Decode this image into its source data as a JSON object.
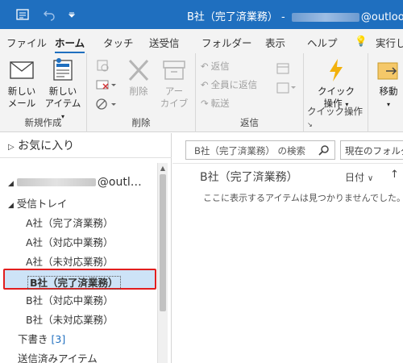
{
  "titlebar": {
    "title_prefix": "B社（完了済業務） - ",
    "title_suffix": "@outlook.",
    "icons": [
      "send-receive-icon",
      "undo-icon",
      "customize-qat-icon"
    ],
    "bg_color": "#1f6fbf"
  },
  "tabs": [
    "ファイル",
    "ホーム",
    "タッチ",
    "送受信",
    "フォルダー",
    "表示",
    "ヘルプ",
    "実行し"
  ],
  "active_tab": "ホーム",
  "ribbon": {
    "new_group": {
      "label": "新規作成",
      "new_mail_line1": "新しい",
      "new_mail_line2": "メール",
      "new_items_line1": "新しい",
      "new_items_line2": "アイテム"
    },
    "delete_group": {
      "label": "削除",
      "delete": "削除",
      "archive_line1": "アー",
      "archive_line2": "カイブ"
    },
    "respond_group": {
      "label": "返信",
      "reply": "返信",
      "reply_all": "全員に返信",
      "forward": "転送"
    },
    "quick_group": {
      "label": "クイック操作",
      "quick_line1": "クイック",
      "quick_line2": "操作"
    },
    "move_group": {
      "move": "移動"
    }
  },
  "folder_pane": {
    "favorites": "お気に入り",
    "account_suffix": "@outl…",
    "inbox": "受信トレイ",
    "folders": [
      "A社（完了済業務）",
      "A社（対応中業務）",
      "A社（未対応業務）",
      "B社（完了済業務）",
      "B社（対応中業務）",
      "B社（未対応業務）"
    ],
    "selected_folder": "B社（完了済業務）",
    "drafts": "下書き",
    "drafts_count": "[3]",
    "sent": "送信済みアイテム"
  },
  "message_list": {
    "search_placeholder": "B社（完了済業務） の検索",
    "scope": "現在のフォルダー",
    "folder_title": "B社（完了済業務）",
    "sort_label": "日付",
    "empty_message": "ここに表示するアイテムは見つかりませんでした。"
  }
}
